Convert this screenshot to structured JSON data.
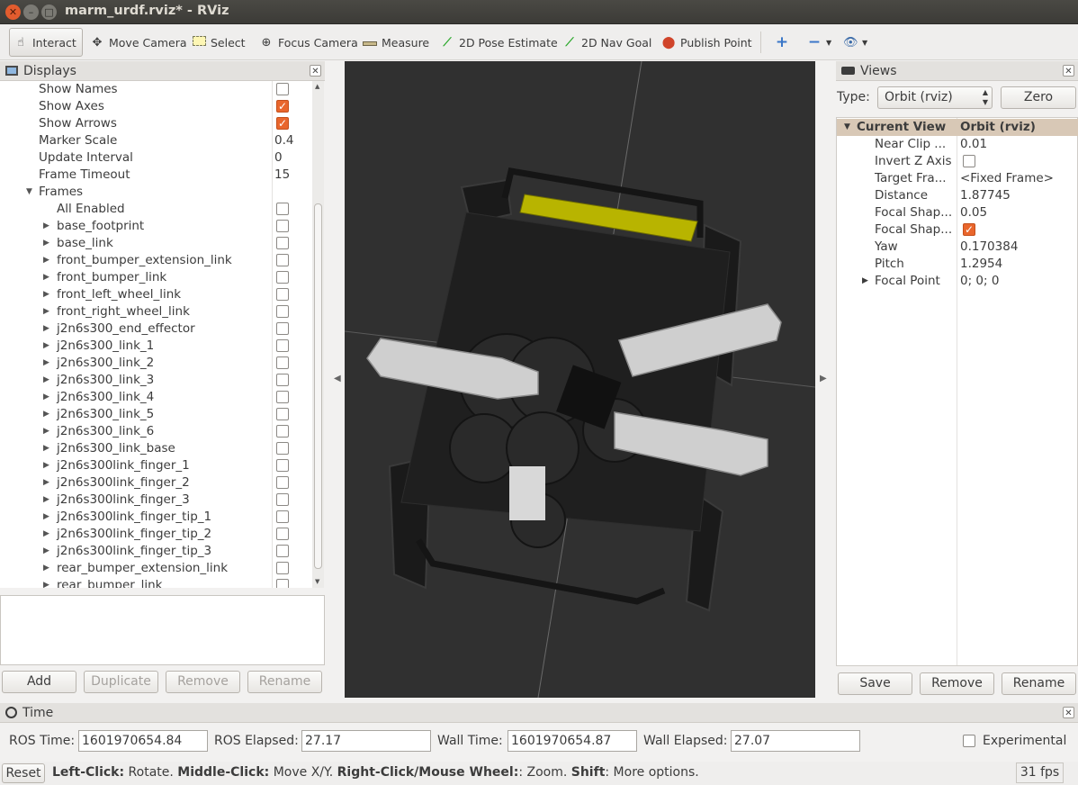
{
  "window": {
    "title": "marm_urdf.rviz* - RViz",
    "close": "✕",
    "minimize": "–",
    "maximize": "□"
  },
  "toolbar": {
    "interact": "Interact",
    "move_camera": "Move Camera",
    "select": "Select",
    "focus_camera": "Focus Camera",
    "measure": "Measure",
    "pose_estimate": "2D Pose Estimate",
    "nav_goal": "2D Nav Goal",
    "publish_point": "Publish Point"
  },
  "displays": {
    "title": "Displays",
    "rows": [
      {
        "label": "Show Names",
        "checked": false
      },
      {
        "label": "Show Axes",
        "checked": true
      },
      {
        "label": "Show Arrows",
        "checked": true
      },
      {
        "label": "Marker Scale",
        "value": "0.4"
      },
      {
        "label": "Update Interval",
        "value": "0"
      },
      {
        "label": "Frame Timeout",
        "value": "15"
      },
      {
        "label": "Frames",
        "expanded": true
      },
      {
        "label": "All Enabled",
        "checked": false
      },
      {
        "label": "base_footprint",
        "checked": false
      },
      {
        "label": "base_link",
        "checked": false
      },
      {
        "label": "front_bumper_extension_link",
        "checked": false
      },
      {
        "label": "front_bumper_link",
        "checked": false
      },
      {
        "label": "front_left_wheel_link",
        "checked": false
      },
      {
        "label": "front_right_wheel_link",
        "checked": false
      },
      {
        "label": "j2n6s300_end_effector",
        "checked": false
      },
      {
        "label": "j2n6s300_link_1",
        "checked": false
      },
      {
        "label": "j2n6s300_link_2",
        "checked": false
      },
      {
        "label": "j2n6s300_link_3",
        "checked": false
      },
      {
        "label": "j2n6s300_link_4",
        "checked": false
      },
      {
        "label": "j2n6s300_link_5",
        "checked": false
      },
      {
        "label": "j2n6s300_link_6",
        "checked": false
      },
      {
        "label": "j2n6s300_link_base",
        "checked": false
      },
      {
        "label": "j2n6s300link_finger_1",
        "checked": false
      },
      {
        "label": "j2n6s300link_finger_2",
        "checked": false
      },
      {
        "label": "j2n6s300link_finger_3",
        "checked": false
      },
      {
        "label": "j2n6s300link_finger_tip_1",
        "checked": false
      },
      {
        "label": "j2n6s300link_finger_tip_2",
        "checked": false
      },
      {
        "label": "j2n6s300link_finger_tip_3",
        "checked": false
      },
      {
        "label": "rear_bumper_extension_link",
        "checked": false
      },
      {
        "label": "rear_bumper_link",
        "checked": false
      }
    ],
    "buttons": {
      "add": "Add",
      "duplicate": "Duplicate",
      "remove": "Remove",
      "rename": "Rename"
    }
  },
  "views": {
    "title": "Views",
    "type_label": "Type:",
    "type_value": "Orbit (rviz)",
    "zero": "Zero",
    "current_view": {
      "label": "Current View",
      "value": "Orbit (rviz)"
    },
    "props": [
      {
        "label": "Near Clip ...",
        "value": "0.01"
      },
      {
        "label": "Invert Z Axis",
        "checked": false
      },
      {
        "label": "Target Fra...",
        "value": "<Fixed Frame>"
      },
      {
        "label": "Distance",
        "value": "1.87745"
      },
      {
        "label": "Focal Shap...",
        "value": "0.05"
      },
      {
        "label": "Focal Shap...",
        "checked": true
      },
      {
        "label": "Yaw",
        "value": "0.170384"
      },
      {
        "label": "Pitch",
        "value": "1.2954"
      },
      {
        "label": "Focal Point",
        "value": "0; 0; 0"
      }
    ],
    "buttons": {
      "save": "Save",
      "remove": "Remove",
      "rename": "Rename"
    }
  },
  "time": {
    "title": "Time",
    "ros_time_label": "ROS Time:",
    "ros_time": "1601970654.84",
    "ros_elapsed_label": "ROS Elapsed:",
    "ros_elapsed": "27.17",
    "wall_time_label": "Wall Time:",
    "wall_time": "1601970654.87",
    "wall_elapsed_label": "Wall Elapsed:",
    "wall_elapsed": "27.07",
    "experimental": "Experimental"
  },
  "status": {
    "reset": "Reset",
    "k1": "Left-Click:",
    "t1": " Rotate. ",
    "k2": "Middle-Click:",
    "t2": " Move X/Y. ",
    "k3": "Right-Click/Mouse Wheel:",
    "t3": ": Zoom. ",
    "k4": "Shift",
    "t4": ": More options.",
    "fps": "31 fps"
  },
  "colors": {
    "check_on": "#e9662c",
    "viewport_bg": "#303030",
    "selected_row": "#d8c8b6"
  }
}
